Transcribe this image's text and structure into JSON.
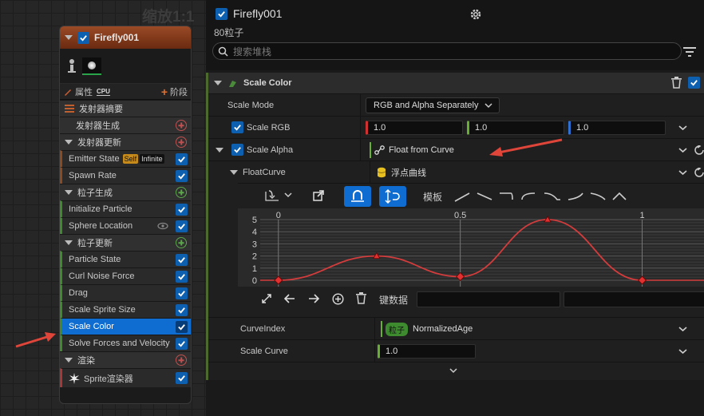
{
  "graph": {
    "zoom": "缩放1:1",
    "node": {
      "title": "Firefly001",
      "tab_properties": "属性",
      "tab_cpu": "CPU",
      "tab_stage": "阶段",
      "sections": [
        {
          "label": "发射器摘要"
        },
        {
          "label": "发射器生成"
        },
        {
          "label": "发射器更新"
        },
        {
          "label": "粒子生成"
        },
        {
          "label": "粒子更新"
        },
        {
          "label": "渲染"
        }
      ],
      "emitter_update_items": [
        {
          "label": "Emitter State",
          "badges": [
            "Self",
            "Infinite"
          ]
        },
        {
          "label": "Spawn Rate"
        }
      ],
      "particle_spawn_items": [
        {
          "label": "Initialize Particle"
        },
        {
          "label": "Sphere Location"
        }
      ],
      "particle_update_items": [
        {
          "label": "Particle State"
        },
        {
          "label": "Curl Noise Force"
        },
        {
          "label": "Drag"
        },
        {
          "label": "Scale Sprite Size"
        },
        {
          "label": "Scale Color"
        },
        {
          "label": "Solve Forces and Velocity"
        }
      ],
      "render_items": [
        {
          "label": "Sprite渲染器"
        }
      ]
    }
  },
  "panel": {
    "title": "Firefly001",
    "subtitle": "80粒子",
    "search_placeholder": "搜索堆栈",
    "section_title": "Scale Color",
    "scale_mode_label": "Scale Mode",
    "scale_mode_value": "RGB and Alpha Separately",
    "scale_rgb_label": "Scale RGB",
    "rgb_values": [
      "1.0",
      "1.0",
      "1.0"
    ],
    "scale_alpha_label": "Scale Alpha",
    "scale_alpha_value": "Float from Curve",
    "float_curve_label": "FloatCurve",
    "float_curve_value": "浮点曲线",
    "template_label": "模板",
    "key_data_label": "键数据",
    "curve_index_label": "CurveIndex",
    "curve_index_badge": "粒子",
    "curve_index_value": "NormalizedAge",
    "scale_curve_label": "Scale Curve",
    "scale_curve_value": "1.0",
    "colors": {
      "accent": "#0f6cd0",
      "curve": "#d23c3c",
      "emitter_rail": "#8a4a22"
    }
  },
  "chart_data": {
    "type": "line",
    "x_ticks": [
      "0",
      "0.5",
      "1"
    ],
    "y_ticks": [
      "0",
      "1",
      "2",
      "3",
      "4",
      "5"
    ],
    "xlim": [
      -0.05,
      1.17
    ],
    "ylim": [
      0,
      5
    ],
    "series": [
      {
        "x": [
          0,
          0.27,
          0.5,
          0.74,
          1.0
        ],
        "values": [
          0,
          2.0,
          0.3,
          5.0,
          0
        ]
      }
    ]
  }
}
